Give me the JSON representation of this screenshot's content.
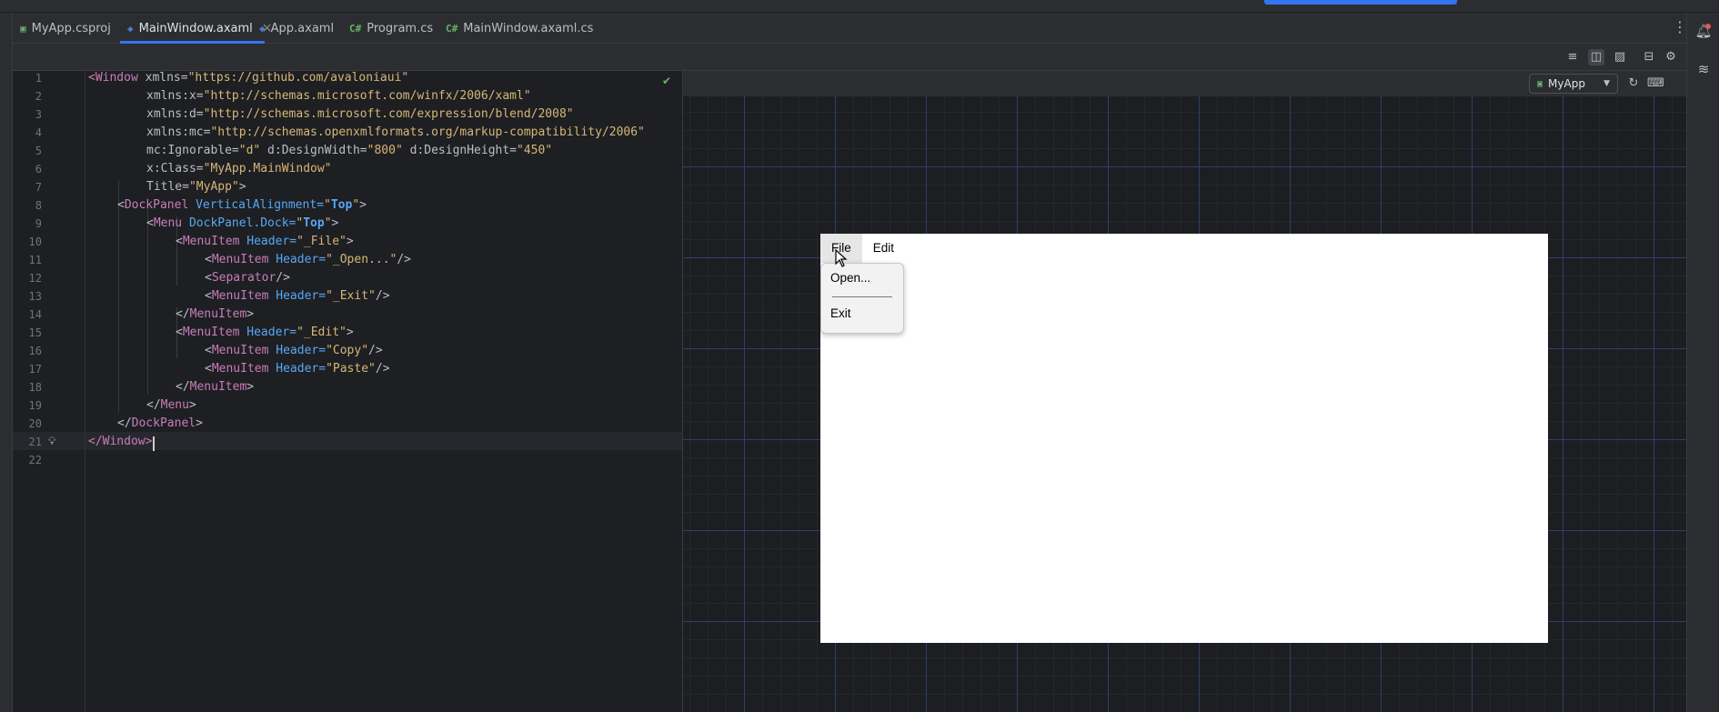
{
  "tabs": [
    {
      "label": "MyApp.csproj",
      "icon": "csproj-icon"
    },
    {
      "label": "MainWindow.axaml",
      "icon": "axaml-icon",
      "active": true
    },
    {
      "label": "App.axaml",
      "icon": "axaml-icon"
    },
    {
      "label": "Program.cs",
      "icon": "csharp-icon"
    },
    {
      "label": "MainWindow.axaml.cs",
      "icon": "csharp-icon"
    }
  ],
  "tab_icons": {
    "cs": "C#"
  },
  "line_numbers": [
    "1",
    "2",
    "3",
    "4",
    "5",
    "6",
    "7",
    "8",
    "9",
    "10",
    "11",
    "12",
    "13",
    "14",
    "15",
    "16",
    "17",
    "18",
    "19",
    "20",
    "21",
    "22"
  ],
  "code": {
    "l1": {
      "open": "<",
      "tag": "Window",
      "attr": " xmlns=",
      "val": "\"https://github.com/avaloniaui\""
    },
    "l2": {
      "ns": "xmlns",
      "sep": ":",
      "attr": "x=",
      "val": "\"http://schemas.microsoft.com/winfx/2006/xaml\""
    },
    "l3": {
      "ns": "xmlns",
      "sep": ":",
      "attr": "d=",
      "val": "\"http://schemas.microsoft.com/expression/blend/2008\""
    },
    "l4": {
      "ns": "xmlns",
      "sep": ":",
      "attr": "mc=",
      "val": "\"http://schemas.openxmlformats.org/markup-compatibility/2006\""
    },
    "l5": {
      "a1": "mc:Ignorable=",
      "v1": "\"d\"",
      "a2": " d:DesignWidth=",
      "v2": "\"800\"",
      "a3": " d:DesignHeight=",
      "v3": "\"450\""
    },
    "l6": {
      "attr": "x:Class=",
      "val": "\"MyApp.MainWindow\""
    },
    "l7": {
      "attr": "Title=",
      "val": "\"MyApp\"",
      "close": ">"
    },
    "l8": {
      "open": "<",
      "tag": "DockPanel",
      "attr": " VerticalAlignment=",
      "q1": "\"",
      "vb": "Top",
      "q2": "\"",
      "close": ">"
    },
    "l9": {
      "open": "<",
      "tag": "Menu",
      "attr": " DockPanel.Dock=",
      "q1": "\"",
      "vb": "Top",
      "q2": "\"",
      "close": ">"
    },
    "l10": {
      "open": "<",
      "tag": "MenuItem",
      "attr": " Header=",
      "val": "\"_File\"",
      "close": ">"
    },
    "l11": {
      "open": "<",
      "tag": "MenuItem",
      "attr": " Header=",
      "val": "\"_Open...\"",
      "close": "/>"
    },
    "l12": {
      "open": "<",
      "tag": "Separator",
      "close": "/>"
    },
    "l13": {
      "open": "<",
      "tag": "MenuItem",
      "attr": " Header=",
      "val": "\"_Exit\"",
      "close": "/>"
    },
    "l14": {
      "open": "</",
      "tag": "MenuItem",
      "close": ">"
    },
    "l15": {
      "open": "<",
      "tag": "MenuItem",
      "attr": " Header=",
      "val": "\"_Edit\"",
      "close": ">"
    },
    "l16": {
      "open": "<",
      "tag": "MenuItem",
      "attr": " Header=",
      "val": "\"Copy\"",
      "close": "/>"
    },
    "l17": {
      "open": "<",
      "tag": "MenuItem",
      "attr": " Header=",
      "val": "\"Paste\"",
      "close": "/>"
    },
    "l18": {
      "open": "</",
      "tag": "MenuItem",
      "close": ">"
    },
    "l19": {
      "open": "</",
      "tag": "Menu",
      "close": ">"
    },
    "l20": {
      "open": "</",
      "tag": "DockPanel",
      "close": ">"
    },
    "l21": {
      "open": "</",
      "tag": "Window",
      "close": ">"
    }
  },
  "preview": {
    "app_selector": "MyApp",
    "menu": [
      "File",
      "Edit"
    ],
    "dropdown": [
      "Open...",
      "Exit"
    ]
  },
  "colors": {
    "accent": "#3574f0",
    "ok": "#5fb865"
  }
}
